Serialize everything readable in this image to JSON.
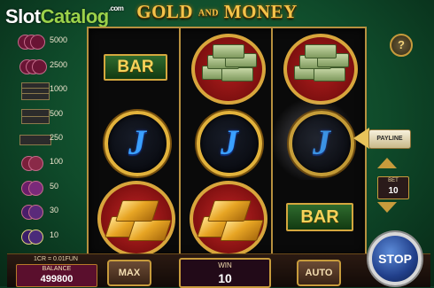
{
  "header": {
    "watermark_part1": "Slot",
    "watermark_part2": "Catalog",
    "watermark_suffix": ".com",
    "title_left": "GOLD",
    "title_mid": "AND",
    "title_right": "MONEY"
  },
  "paytable": [
    {
      "symbol": "red-chips",
      "payout": "5000"
    },
    {
      "symbol": "red-chips-small",
      "payout": "2500"
    },
    {
      "symbol": "triple-bar",
      "payout": "1000"
    },
    {
      "symbol": "double-bar",
      "payout": "500"
    },
    {
      "symbol": "single-bar",
      "payout": "250"
    },
    {
      "symbol": "chip-a",
      "payout": "100"
    },
    {
      "symbol": "chip-b",
      "payout": "50"
    },
    {
      "symbol": "chip-c",
      "payout": "30"
    },
    {
      "symbol": "chip-d",
      "payout": "10"
    }
  ],
  "reels": {
    "symbol_labels": {
      "bar": "BAR",
      "j": "J"
    },
    "grid": [
      [
        "bar",
        "money",
        "money"
      ],
      [
        "j",
        "j",
        "j"
      ],
      [
        "gold",
        "gold",
        "bar"
      ]
    ]
  },
  "controls": {
    "help_label": "?",
    "payline_label": "PAYLINE",
    "bet_label": "BET",
    "bet_value": "10",
    "credit_rate": "1CR = 0.01FUN",
    "balance_label": "BALANCE",
    "balance_value": "499800",
    "max_label": "MAX",
    "win_label": "WIN",
    "win_value": "10",
    "auto_label": "AUTO",
    "stop_label": "STOP"
  },
  "colors": {
    "background": "#0f4a2a",
    "frame_gold": "#b7903f",
    "title_gold": "#f3c34a",
    "balance_panel": "#5a0f2d",
    "stop_blue": "#213f8a"
  }
}
